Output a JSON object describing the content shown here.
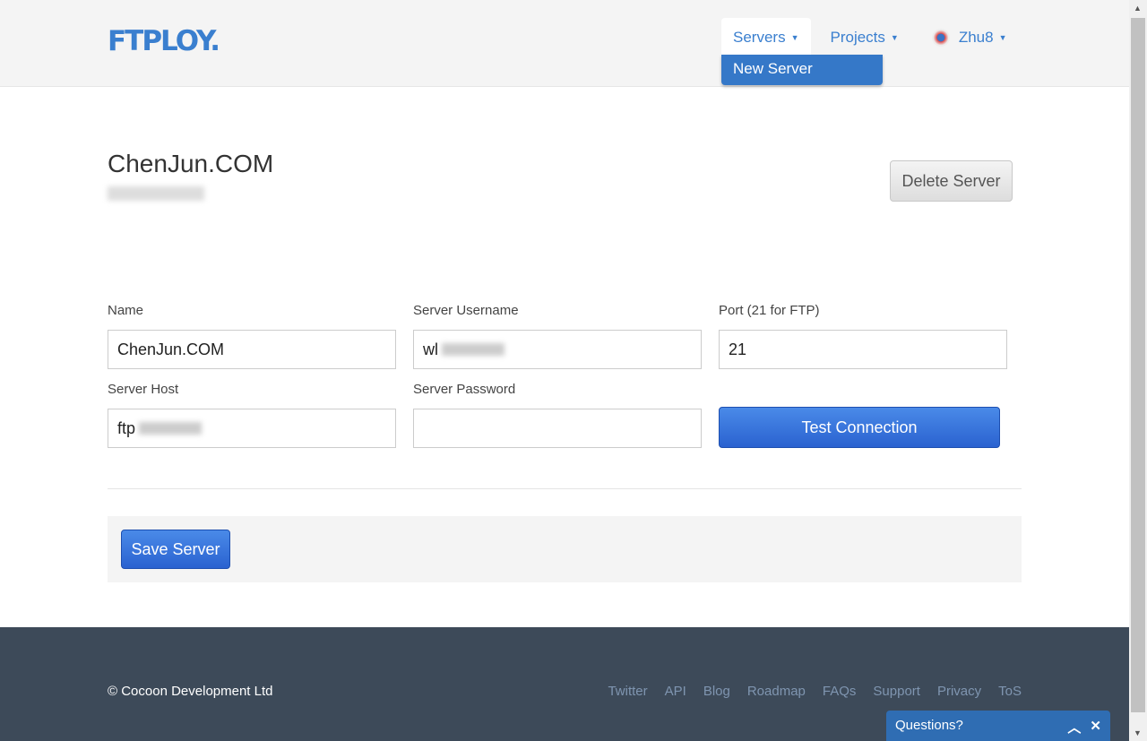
{
  "header": {
    "logo": "FTPLOY.",
    "nav": [
      {
        "label": "Servers"
      },
      {
        "label": "Projects"
      },
      {
        "label": "Zhu8"
      }
    ],
    "dropdown": {
      "items": [
        "New Server"
      ]
    }
  },
  "server": {
    "title": "ChenJun.COM",
    "delete_label": "Delete Server"
  },
  "form": {
    "name": {
      "label": "Name",
      "value": "ChenJun.COM"
    },
    "username": {
      "label": "Server Username",
      "value": "wl"
    },
    "port": {
      "label": "Port (21 for FTP)",
      "value": "21"
    },
    "host": {
      "label": "Server Host",
      "value": "ftp"
    },
    "password": {
      "label": "Server Password",
      "value": ""
    },
    "test_label": "Test Connection",
    "save_label": "Save Server"
  },
  "footer": {
    "copyright": "© Cocoon Development Ltd",
    "links": [
      "Twitter",
      "API",
      "Blog",
      "Roadmap",
      "FAQs",
      "Support",
      "Privacy",
      "ToS"
    ]
  },
  "chat": {
    "label": "Questions?"
  },
  "colors": {
    "brand": "#3a7fcf",
    "primary_button": "#2a62d0",
    "footer": "#3d4a59"
  }
}
